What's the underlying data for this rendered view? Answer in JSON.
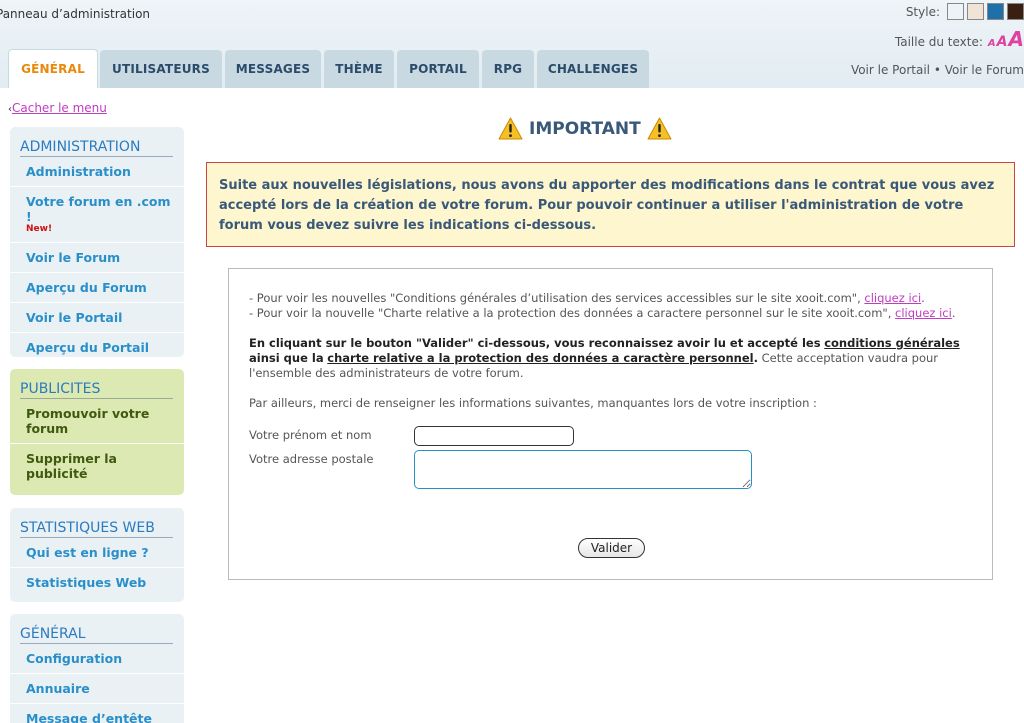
{
  "header": {
    "panel_title": "Panneau d’administration",
    "style_label": "Style:",
    "style_swatches": [
      "#ecf4f8",
      "#f0e4d6",
      "#1f6fa8",
      "#3a1e12"
    ],
    "text_size_label": "Taille du texte:",
    "text_size_letters": [
      "A",
      "A",
      "A"
    ]
  },
  "tabs": [
    {
      "label": "GÉNÉRAL",
      "active": true
    },
    {
      "label": "UTILISATEURS",
      "active": false
    },
    {
      "label": "MESSAGES",
      "active": false
    },
    {
      "label": "THÈME",
      "active": false
    },
    {
      "label": "PORTAIL",
      "active": false
    },
    {
      "label": "RPG",
      "active": false
    },
    {
      "label": "CHALLENGES",
      "active": false
    }
  ],
  "top_links": {
    "portal": "Voir le Portail",
    "separator": "•",
    "forum": "Voir le Forum"
  },
  "sidebar": {
    "hide_menu": "Cacher le menu",
    "sections": [
      {
        "title": "ADMINISTRATION",
        "items": [
          {
            "label": "Administration"
          },
          {
            "label": "Votre forum en .com !",
            "badge": "New!"
          },
          {
            "label": "Voir le Forum"
          },
          {
            "label": "Aperçu du Forum"
          },
          {
            "label": "Voir le Portail"
          },
          {
            "label": "Aperçu du Portail"
          }
        ]
      },
      {
        "title": "PUBLICITES",
        "items": [
          {
            "label": "Promouvoir votre forum"
          },
          {
            "label": "Supprimer la publicité"
          }
        ]
      },
      {
        "title": "STATISTIQUES WEB",
        "items": [
          {
            "label": "Qui est en ligne ?"
          },
          {
            "label": "Statistiques Web"
          }
        ]
      },
      {
        "title": "GÉNÉRAL",
        "items": [
          {
            "label": "Configuration"
          },
          {
            "label": "Annuaire"
          },
          {
            "label": "Message d’entête"
          }
        ]
      }
    ]
  },
  "main": {
    "important_title": "IMPORTANT",
    "alert_text": "Suite aux nouvelles législations, nous avons du apporter des modifications dans le contrat que vous avez accepté lors de la création de votre forum. Pour pouvoir continuer a utiliser l'administration de votre forum vous devez suivre les indications ci-dessous.",
    "line1_text": "-   Pour voir les nouvelles \"Conditions générales d’utilisation des services accessibles sur le site xooit.com\",",
    "line1_link": "cliquez ici",
    "line2_text": "-   Pour voir la nouvelle \"Charte relative a la protection des données a caractere personnel sur le site xooit.com\",",
    "line2_link": "cliquez ici",
    "accept_part1": "En cliquant sur le bouton \"Valider\" ci-dessous, vous reconnaissez avoir lu et accepté les",
    "accept_link1": "conditions générales",
    "accept_part2": "ainsi que la",
    "accept_link2": "charte relative a la protection des données a caractère personnel",
    "accept_part3": "Cette acceptation vaudra pour l'ensemble des administrateurs de votre forum.",
    "info_text": "Par ailleurs, merci de renseigner les informations suivantes, manquantes lors de votre inscription :",
    "fullname_label": "Votre prénom et nom",
    "fullname_value": "",
    "address_label": "Votre adresse postale",
    "address_value": "",
    "validate_label": "Valider"
  }
}
